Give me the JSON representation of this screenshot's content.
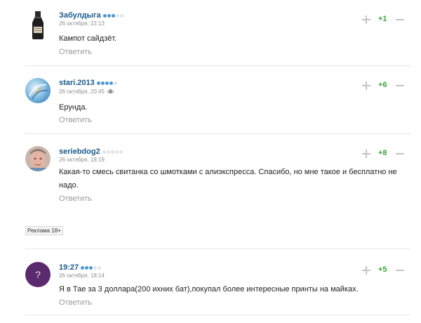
{
  "comments": [
    {
      "author": "Забулдыга",
      "date": "26 октября, 22:13",
      "text": "Кампот сайдзёт.",
      "reply": "Ответить",
      "score": "+1",
      "rating_dots": 3,
      "avatar": "bottle"
    },
    {
      "author": "stari.2013",
      "date": "26 октября, 20:45",
      "text": "Ерунда.",
      "reply": "Ответить",
      "score": "+6",
      "rating_dots": 4,
      "avatar": "blue-abstract",
      "mobile_icon": "android-icon"
    },
    {
      "author": "seriebdog2",
      "date": "26 октября, 18:19",
      "text": "Какая-то смесь свитанка со шмотками с алиэкспресса. Спасибо, но мне такое и бесплатно не надо.",
      "reply": "Ответить",
      "score": "+8",
      "rating_dots": 0,
      "avatar": "face-photo"
    },
    {
      "author": "19:27",
      "date": "26 октября, 18:14",
      "text": "Я в Тае за 3 доллара(200 ихних бат),покупал более интересные принты на майках.",
      "reply": "Ответить",
      "score": "+5",
      "rating_dots": 3,
      "avatar": "question-mark",
      "avatar_glyph": "?"
    }
  ],
  "ad_badge": "Реклама 18+",
  "colors": {
    "author": "#1a5a8c",
    "score": "#3ba53b",
    "dot_active": "#4f98d0",
    "dot_inactive": "#dfe5ea",
    "avatar_question_bg": "#5b2a6e"
  }
}
